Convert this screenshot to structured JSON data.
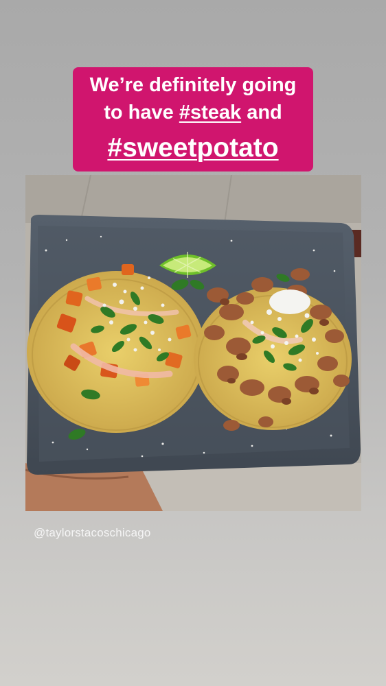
{
  "story": {
    "caption": {
      "line1": "We’re definitely going",
      "line2_before": "to have ",
      "line2_hashtag": "#steak",
      "line2_after": " and",
      "line3_hashtag": "#sweetpotato",
      "background_color": "#d0156e",
      "text_color": "#ffffff"
    },
    "photo": {
      "subject": "two tacos on a gray rectangular plate with a lime wedge"
    },
    "mention": "@taylorstacoschicago"
  }
}
